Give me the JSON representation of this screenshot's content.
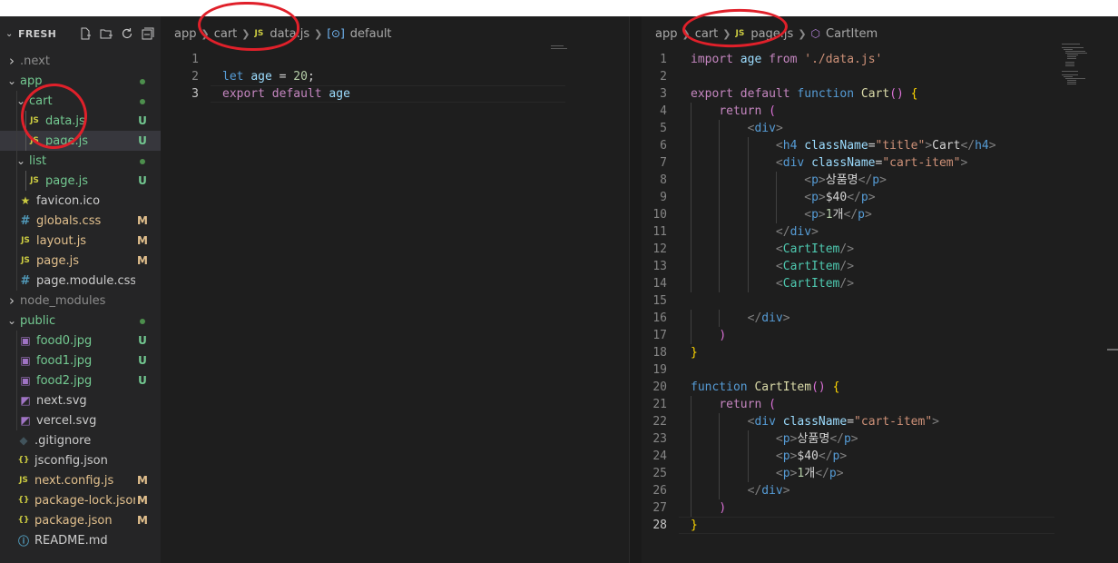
{
  "explorer": {
    "title": "FRESH",
    "actions": [
      "new-file-icon",
      "new-folder-icon",
      "refresh-icon",
      "collapse-all-icon"
    ],
    "items": [
      {
        "label": ".next",
        "type": "folder",
        "depth": 0,
        "expanded": false,
        "color": "dim",
        "status": ""
      },
      {
        "label": "app",
        "type": "folder",
        "depth": 0,
        "expanded": true,
        "color": "untracked",
        "status": "dot"
      },
      {
        "label": "cart",
        "type": "folder",
        "depth": 1,
        "expanded": true,
        "color": "untracked",
        "status": "dot"
      },
      {
        "label": "data.js",
        "type": "js",
        "depth": 2,
        "color": "untracked",
        "status": "U"
      },
      {
        "label": "page.js",
        "type": "js",
        "depth": 2,
        "color": "untracked",
        "status": "U",
        "selected": true
      },
      {
        "label": "list",
        "type": "folder",
        "depth": 1,
        "expanded": true,
        "color": "untracked",
        "status": "dot"
      },
      {
        "label": "page.js",
        "type": "js",
        "depth": 2,
        "color": "untracked",
        "status": "U"
      },
      {
        "label": "favicon.ico",
        "type": "star",
        "depth": 1,
        "color": "plain",
        "status": ""
      },
      {
        "label": "globals.css",
        "type": "css",
        "depth": 1,
        "color": "modified",
        "status": "M"
      },
      {
        "label": "layout.js",
        "type": "js",
        "depth": 1,
        "color": "modified",
        "status": "M"
      },
      {
        "label": "page.js",
        "type": "js",
        "depth": 1,
        "color": "modified",
        "status": "M"
      },
      {
        "label": "page.module.css",
        "type": "css",
        "depth": 1,
        "color": "plain",
        "status": ""
      },
      {
        "label": "node_modules",
        "type": "folder",
        "depth": 0,
        "expanded": false,
        "color": "dim",
        "status": ""
      },
      {
        "label": "public",
        "type": "folder",
        "depth": 0,
        "expanded": true,
        "color": "untracked",
        "status": "dot"
      },
      {
        "label": "food0.jpg",
        "type": "img",
        "depth": 1,
        "color": "untracked",
        "status": "U"
      },
      {
        "label": "food1.jpg",
        "type": "img",
        "depth": 1,
        "color": "untracked",
        "status": "U"
      },
      {
        "label": "food2.jpg",
        "type": "img",
        "depth": 1,
        "color": "untracked",
        "status": "U"
      },
      {
        "label": "next.svg",
        "type": "svg",
        "depth": 1,
        "color": "plain",
        "status": ""
      },
      {
        "label": "vercel.svg",
        "type": "svg",
        "depth": 1,
        "color": "plain",
        "status": ""
      },
      {
        "label": ".gitignore",
        "type": "git",
        "depth": 0,
        "color": "plain",
        "status": ""
      },
      {
        "label": "jsconfig.json",
        "type": "json",
        "depth": 0,
        "color": "plain",
        "status": ""
      },
      {
        "label": "next.config.js",
        "type": "js",
        "depth": 0,
        "color": "modified",
        "status": "M"
      },
      {
        "label": "package-lock.json",
        "type": "json",
        "depth": 0,
        "color": "modified",
        "status": "M"
      },
      {
        "label": "package.json",
        "type": "json",
        "depth": 0,
        "color": "modified",
        "status": "M"
      },
      {
        "label": "README.md",
        "type": "info",
        "depth": 0,
        "color": "plain",
        "status": ""
      }
    ]
  },
  "editor_left": {
    "breadcrumb": {
      "root": "app",
      "folder": "cart",
      "file_badge": "JS",
      "file": "data.js",
      "symbol": "default"
    },
    "cursor_line": 3,
    "lines": [
      "",
      "let age = 20;",
      "export default age"
    ]
  },
  "editor_right": {
    "breadcrumb": {
      "root": "app",
      "folder": "cart",
      "file_badge": "JS",
      "file": "page.js",
      "symbol": "CartItem"
    },
    "cursor_line": 28,
    "lines": [
      "import age from './data.js'",
      "",
      "export default function Cart() {",
      "    return (",
      "        <div>",
      "            <h4 className=\"title\">Cart</h4>",
      "            <div className=\"cart-item\">",
      "                <p>상품명</p>",
      "                <p>$40</p>",
      "                <p>1개</p>",
      "            </div>",
      "            <CartItem/>",
      "            <CartItem/>",
      "            <CartItem/>",
      "",
      "        </div>",
      "    )",
      "}",
      "",
      "function CartItem() {",
      "    return (",
      "        <div className=\"cart-item\">",
      "            <p>상품명</p>",
      "            <p>$40</p>",
      "            <p>1개</p>",
      "        </div>",
      "    )",
      "}"
    ]
  },
  "colors": {
    "untracked": "#73c991",
    "modified": "#e2c08d",
    "annotation": "#e0202a"
  }
}
